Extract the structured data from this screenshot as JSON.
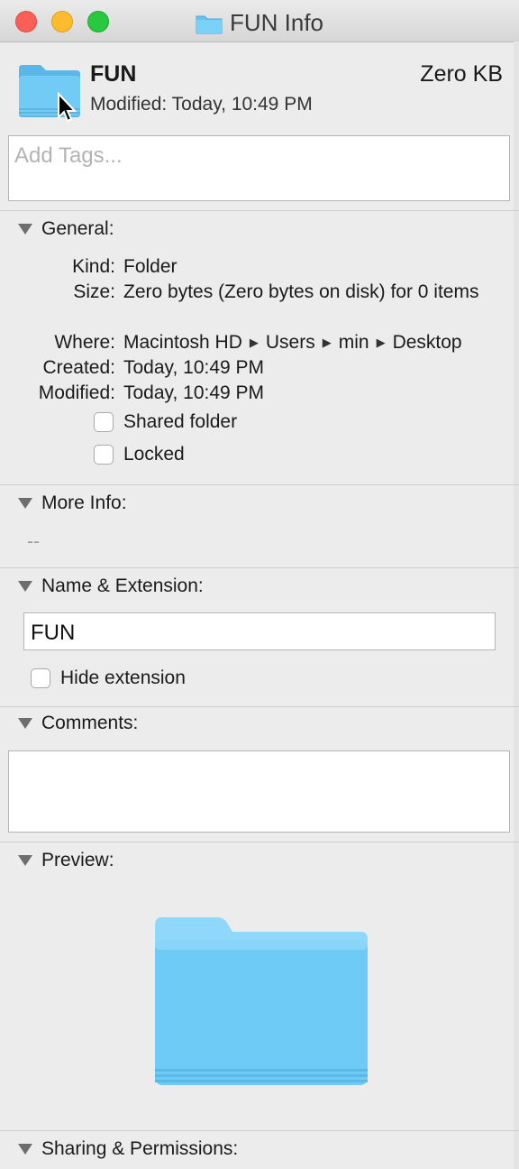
{
  "window": {
    "title": "FUN Info"
  },
  "header": {
    "name": "FUN",
    "size": "Zero KB",
    "modified": "Modified:  Today, 10:49 PM",
    "tags_placeholder": "Add Tags..."
  },
  "general": {
    "heading": "General:",
    "rows": [
      {
        "label": "Kind:",
        "value": "Folder"
      },
      {
        "label": "Size:",
        "value": "Zero bytes (Zero bytes on disk) for 0 items"
      },
      {
        "label": "Where:",
        "path": [
          "Macintosh HD",
          "Users",
          "min",
          "Desktop"
        ]
      },
      {
        "label": "Created:",
        "value": "Today, 10:49 PM"
      },
      {
        "label": "Modified:",
        "value": "Today, 10:49 PM"
      }
    ],
    "shared_folder": {
      "label": "Shared folder",
      "checked": false
    },
    "locked": {
      "label": "Locked",
      "checked": false
    }
  },
  "more_info": {
    "heading": "More Info:",
    "value": "--"
  },
  "name_extension": {
    "heading": "Name & Extension:",
    "name_value": "FUN",
    "hide_extension": {
      "label": "Hide extension",
      "checked": false
    }
  },
  "comments": {
    "heading": "Comments:"
  },
  "preview": {
    "heading": "Preview:"
  },
  "sharing": {
    "heading": "Sharing & Permissions:"
  },
  "colors": {
    "folder_blue": "#6ccaf5",
    "close": "#fc5f57",
    "minimize": "#fdbc2e",
    "zoom": "#28c840"
  }
}
